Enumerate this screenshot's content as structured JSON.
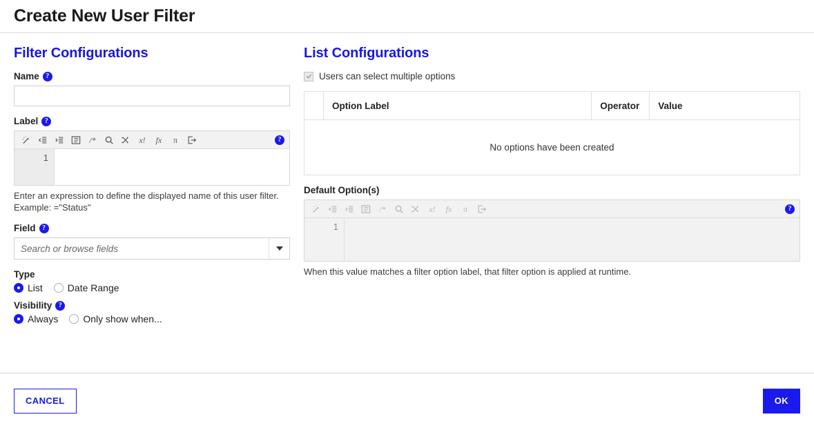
{
  "dialog": {
    "title": "Create New User Filter"
  },
  "filter_configurations": {
    "section_title": "Filter Configurations",
    "name": {
      "label": "Name",
      "help_icon": "help-circle-icon",
      "value": "",
      "placeholder": ""
    },
    "label": {
      "label": "Label",
      "help_icon": "help-circle-icon",
      "line_number": "1",
      "code": "",
      "hint": "Enter an expression to define the displayed name of this user filter. Example: =\"Status\""
    },
    "field": {
      "label": "Field",
      "help_icon": "help-circle-icon",
      "value": "",
      "placeholder": "Search or browse fields",
      "caret_icon": "chevron-down-icon"
    },
    "type": {
      "label": "Type",
      "options": [
        {
          "label": "List",
          "selected": true
        },
        {
          "label": "Date Range",
          "selected": false
        }
      ]
    },
    "visibility": {
      "label": "Visibility",
      "help_icon": "help-circle-icon",
      "options": [
        {
          "label": "Always",
          "selected": true
        },
        {
          "label": "Only show when...",
          "selected": false
        }
      ]
    }
  },
  "list_configurations": {
    "section_title": "List Configurations",
    "multi_select": {
      "label": "Users can select multiple options",
      "checked": true,
      "disabled": true
    },
    "options_table": {
      "columns": [
        "",
        "Option Label",
        "Operator",
        "Value"
      ],
      "rows": [],
      "empty_message": "No options have been created"
    },
    "default_options": {
      "label": "Default Option(s)",
      "help_icon": "help-circle-icon",
      "line_number": "1",
      "code": "",
      "disabled": true,
      "hint": "When this value matches a filter option label, that filter option is applied at runtime."
    }
  },
  "editor_toolbar": {
    "buttons": [
      {
        "name": "magic-wand-icon",
        "title": "Format expression"
      },
      {
        "name": "outdent-icon",
        "title": "Outdent"
      },
      {
        "name": "indent-icon",
        "title": "Indent"
      },
      {
        "name": "align-text-icon",
        "title": "Align"
      },
      {
        "name": "comment-icon",
        "title": "Comment",
        "glyph": "/*"
      },
      {
        "name": "search-icon",
        "title": "Find"
      },
      {
        "name": "shuffle-icon",
        "title": "Swap"
      },
      {
        "name": "variable-icon",
        "title": "Variables",
        "glyph": "x!"
      },
      {
        "name": "function-icon",
        "title": "Functions",
        "glyph": "fx"
      },
      {
        "name": "pi-icon",
        "title": "Constants",
        "glyph": "π"
      },
      {
        "name": "export-icon",
        "title": "Export"
      }
    ],
    "help_icon": "help-circle-icon"
  },
  "footer": {
    "cancel_label": "CANCEL",
    "ok_label": "OK"
  },
  "colors": {
    "accent": "#1a1aee",
    "section_heading": "#1717e0",
    "text": "#212121",
    "border": "#d8d8d8",
    "disabled_bg": "#f2f2f2"
  }
}
